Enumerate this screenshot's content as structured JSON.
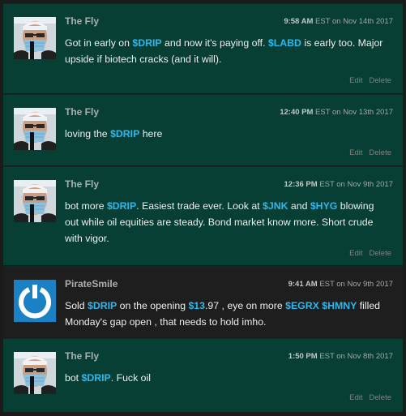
{
  "app": {
    "accent": "#2db8ee"
  },
  "posts": [
    {
      "username": "The Fly",
      "time": "9:58 AM",
      "date_suffix": " EST on Nov 14th 2017",
      "own": true,
      "avatar_icon": "masked-face-avatar",
      "actions": [
        "Edit",
        "Delete"
      ],
      "body": [
        {
          "t": "Got in early on "
        },
        {
          "t": "$DRIP",
          "tk": true
        },
        {
          "t": " and now it's paying off. "
        },
        {
          "t": "$LABD",
          "tk": true
        },
        {
          "t": " is early too. Major upside if biotech cracks (and it will)."
        }
      ]
    },
    {
      "username": "The Fly",
      "time": "12:40 PM",
      "date_suffix": " EST on Nov 13th 2017",
      "own": true,
      "avatar_icon": "masked-face-avatar",
      "actions": [
        "Edit",
        "Delete"
      ],
      "body": [
        {
          "t": "loving the "
        },
        {
          "t": "$DRIP",
          "tk": true
        },
        {
          "t": " here"
        }
      ]
    },
    {
      "username": "The Fly",
      "time": "12:36 PM",
      "date_suffix": " EST on Nov 9th 2017",
      "own": true,
      "avatar_icon": "masked-face-avatar",
      "actions": [
        "Edit",
        "Delete"
      ],
      "body": [
        {
          "t": "bot more "
        },
        {
          "t": "$DRIP",
          "tk": true
        },
        {
          "t": ". Easiest trade ever. Look at "
        },
        {
          "t": "$JNK",
          "tk": true
        },
        {
          "t": " and "
        },
        {
          "t": "$HYG",
          "tk": true
        },
        {
          "t": " blowing out while oil equities are steady. Bond market know more. Short crude with vigor."
        }
      ]
    },
    {
      "username": "PirateSmile",
      "time": "9:41 AM",
      "date_suffix": " EST on Nov 9th 2017",
      "own": false,
      "avatar_icon": "power-ring-avatar",
      "actions": [],
      "body": [
        {
          "t": "Sold "
        },
        {
          "t": "$DRIP",
          "tk": true
        },
        {
          "t": " on the opening "
        },
        {
          "t": "$13",
          "tk": true
        },
        {
          "t": ".97 , eye on more "
        },
        {
          "t": "$EGRX",
          "tk": true
        },
        {
          "t": " "
        },
        {
          "t": "$HMNY",
          "tk": true
        },
        {
          "t": " filled Monday's gap open , that needs to hold imho."
        }
      ]
    },
    {
      "username": "The Fly",
      "time": "1:50 PM",
      "date_suffix": " EST on Nov 8th 2017",
      "own": true,
      "avatar_icon": "masked-face-avatar",
      "actions": [
        "Edit",
        "Delete"
      ],
      "body": [
        {
          "t": "bot "
        },
        {
          "t": "$DRIP",
          "tk": true
        },
        {
          "t": ". Fuck oil"
        }
      ]
    }
  ]
}
